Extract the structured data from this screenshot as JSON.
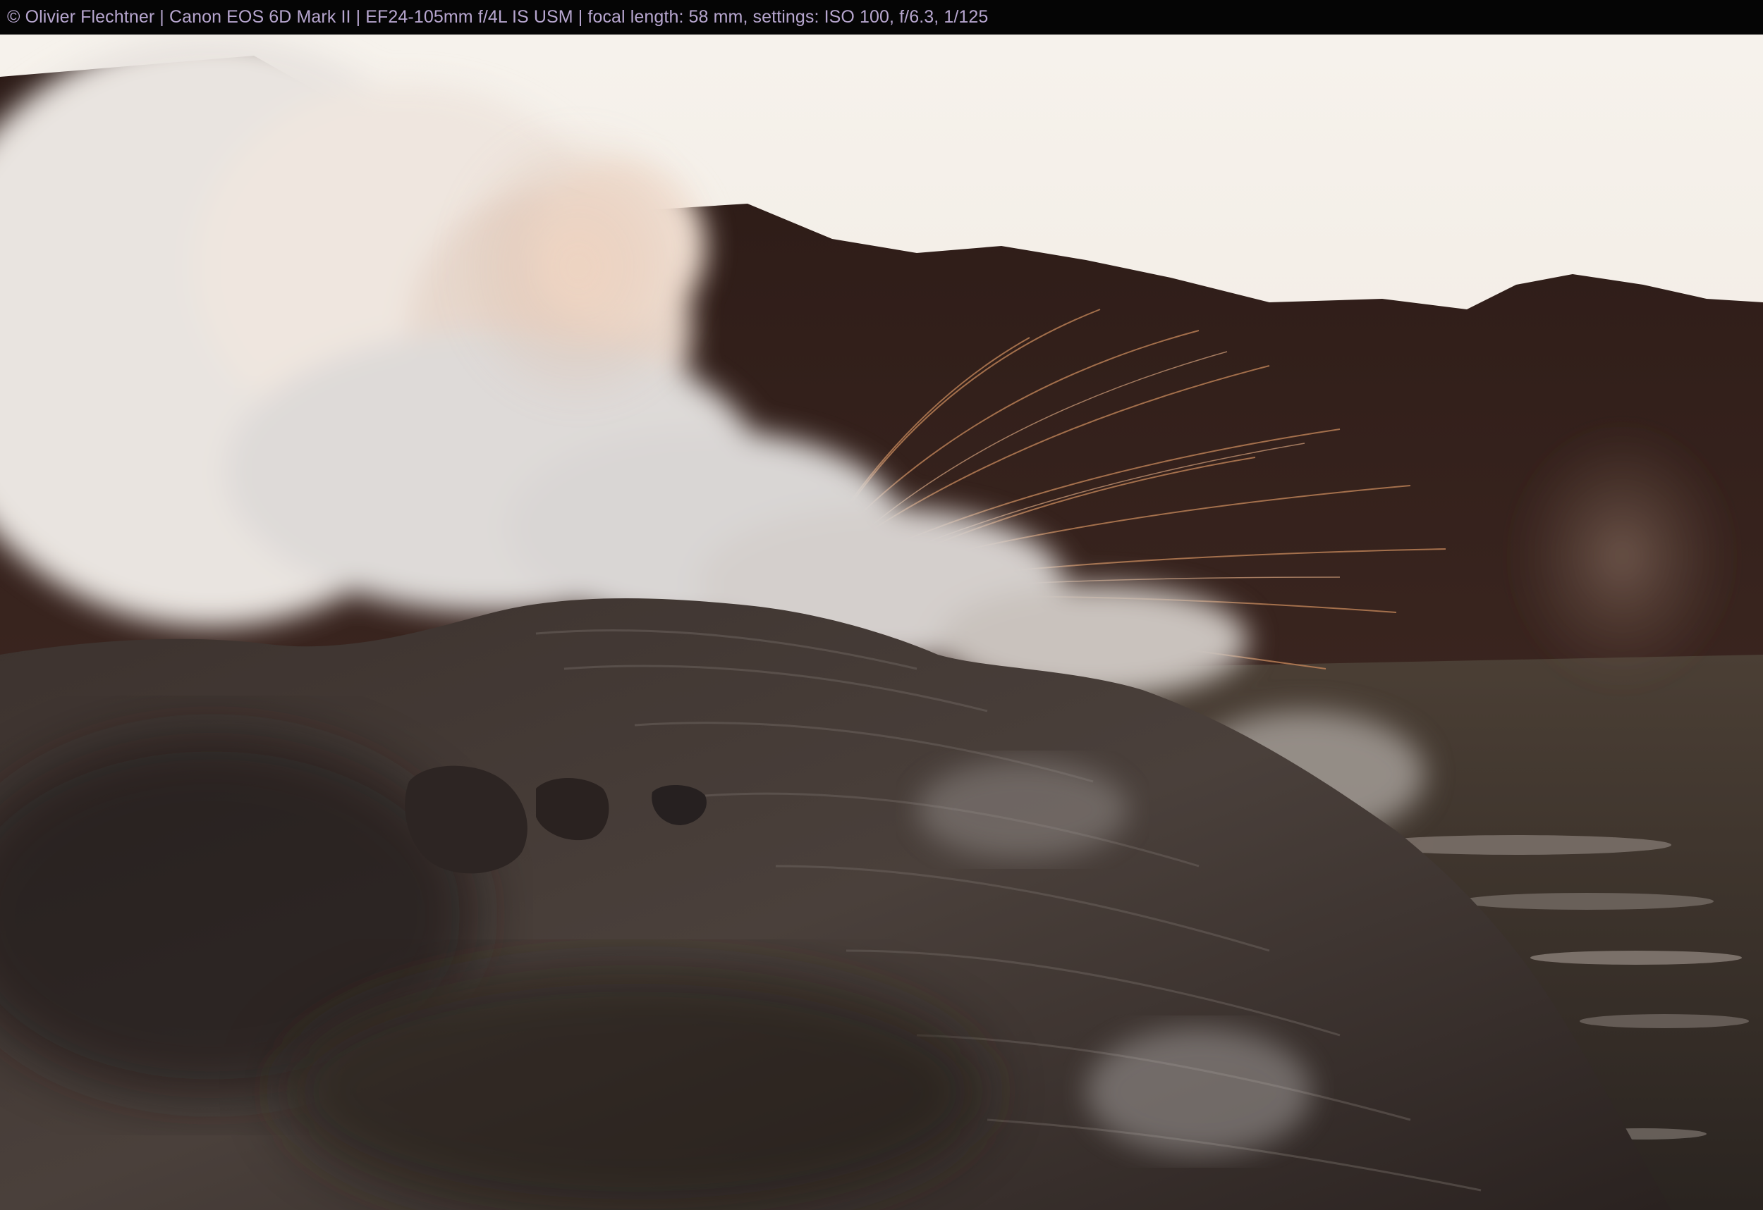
{
  "caption": {
    "text": "© Olivier Flechtner | Canon EOS 6D Mark II | EF24-105mm f/4L IS USM | focal length: 58 mm, settings: ISO 100, f/6.3, 1/125"
  },
  "photo": {
    "subject": "steaming geyser mound at dawn with water spray, dark mountain ridge behind",
    "colors": {
      "sky": "#f3ede6",
      "ridge": "#2a1a17",
      "mound": "#3a302c",
      "steam": "#e8dfd8",
      "spray": "#c98a5c",
      "caption_text": "#b7a6cf"
    }
  }
}
